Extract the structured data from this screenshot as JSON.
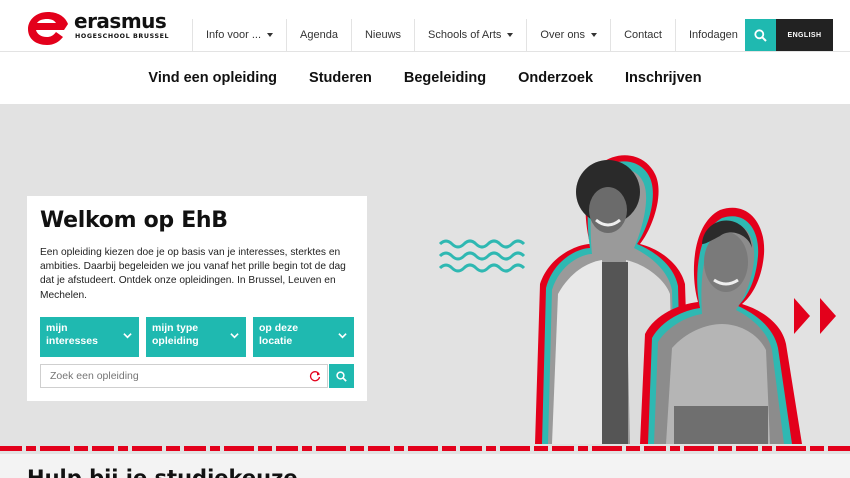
{
  "brand": {
    "name": "erasmus",
    "subtitle": "HOGESCHOOL BRUSSEL",
    "red": "#e3001b",
    "teal": "#1fb9b0"
  },
  "topnav": {
    "items": [
      {
        "label": "Info voor ...",
        "has_dropdown": true
      },
      {
        "label": "Agenda",
        "has_dropdown": false
      },
      {
        "label": "Nieuws",
        "has_dropdown": false
      },
      {
        "label": "Schools of Arts",
        "has_dropdown": true
      },
      {
        "label": "Over ons",
        "has_dropdown": true
      },
      {
        "label": "Contact",
        "has_dropdown": false
      },
      {
        "label": "Infodagen",
        "has_dropdown": false
      }
    ],
    "search_icon": "search-icon",
    "language_label": "ENGLISH"
  },
  "mainnav": {
    "items": [
      "Vind een opleiding",
      "Studeren",
      "Begeleiding",
      "Onderzoek",
      "Inschrijven"
    ]
  },
  "hero": {
    "title": "Welkom op EhB",
    "text": "Een opleiding kiezen doe je op basis van je interesses, sterktes en ambities. Daarbij begeleiden we jou vanaf het prille begin tot de dag dat je afstudeert. Ontdek onze opleidingen. In Brussel, Leuven en Mechelen.",
    "filters": [
      {
        "label": "mijn interesses"
      },
      {
        "label": "mijn type opleiding"
      },
      {
        "label": "op deze locatie"
      }
    ],
    "search_placeholder": "Zoek een opleiding"
  },
  "section": {
    "heading": "Hulp bij je studiekeuze"
  }
}
